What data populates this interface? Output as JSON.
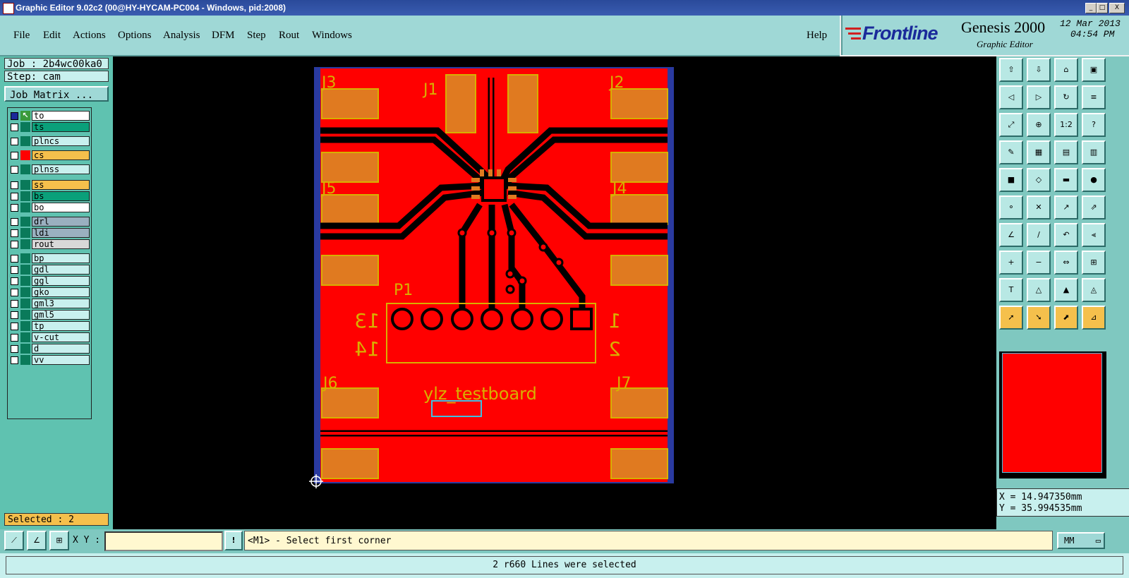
{
  "window": {
    "title": "Graphic Editor 9.02c2 (00@HY-HYCAM-PC004 - Windows, pid:2008)",
    "controls": [
      "_",
      "□",
      "X"
    ]
  },
  "menu": {
    "items": [
      "File",
      "Edit",
      "Actions",
      "Options",
      "Analysis",
      "DFM",
      "Step",
      "Rout",
      "Windows"
    ],
    "help": "Help"
  },
  "brand": {
    "logo": "Frontline",
    "product": "Genesis 2000",
    "subtitle": "Graphic Editor",
    "date": "12 Mar 2013",
    "time": "04:54 PM"
  },
  "left": {
    "job": "Job : 2b4wc00ka0",
    "step": "Step: cam",
    "job_matrix": "Job Matrix ...",
    "selected": "Selected : 2"
  },
  "layers": [
    {
      "name": "to",
      "color": "#ffffff",
      "slot": "#0a7a5a",
      "icon": "arrow"
    },
    {
      "name": "ts",
      "color": "#0aa07a",
      "slot": "#0a7a5a"
    },
    {
      "name": "plncs",
      "color": "#c8f0ee",
      "slot": "#0a7a5a"
    },
    {
      "name": "cs",
      "color": "#f5c04c",
      "slot": "#ff0000"
    },
    {
      "name": "plnss",
      "color": "#c8f0ee",
      "slot": "#0a7a5a"
    },
    {
      "name": "ss",
      "color": "#f5c04c",
      "slot": "#0a7a5a"
    },
    {
      "name": "bs",
      "color": "#0aa07a",
      "slot": "#0a7a5a"
    },
    {
      "name": "bo",
      "color": "#ffffff",
      "slot": "#0a7a5a"
    },
    {
      "name": "drl",
      "color": "#9ab0c0",
      "slot": "#0a7a5a"
    },
    {
      "name": "ldi",
      "color": "#9ab0c0",
      "slot": "#0a7a5a"
    },
    {
      "name": "rout",
      "color": "#d8d8d8",
      "slot": "#0a7a5a"
    },
    {
      "name": "bp",
      "color": "#c8f0ee",
      "slot": "#0a7a5a"
    },
    {
      "name": "gdl",
      "color": "#c8f0ee",
      "slot": "#0a7a5a"
    },
    {
      "name": "ggl",
      "color": "#c8f0ee",
      "slot": "#0a7a5a"
    },
    {
      "name": "gko",
      "color": "#c8f0ee",
      "slot": "#0a7a5a"
    },
    {
      "name": "gml3",
      "color": "#c8f0ee",
      "slot": "#0a7a5a"
    },
    {
      "name": "gml5",
      "color": "#c8f0ee",
      "slot": "#0a7a5a"
    },
    {
      "name": "tp",
      "color": "#c8f0ee",
      "slot": "#0a7a5a"
    },
    {
      "name": "v-cut",
      "color": "#c8f0ee",
      "slot": "#0a7a5a"
    },
    {
      "name": "d",
      "color": "#c8f0ee",
      "slot": "#0a7a5a"
    },
    {
      "name": "vv",
      "color": "#c8f0ee",
      "slot": "#0a7a5a"
    }
  ],
  "board": {
    "labels": {
      "j1": "J1",
      "j2": "J2",
      "j3": "J3",
      "j4": "J4",
      "j5": "J5",
      "j6": "J6",
      "j7": "J7",
      "p1": "P1",
      "n13": "13",
      "n14": "14",
      "n1": "1",
      "n2": "2",
      "name": "ylz_testboard"
    },
    "colors": {
      "copper": "#ff0000",
      "pad": "#e07a20",
      "silk": "#d8b000",
      "outline": "#2a3aa0",
      "select": "#40c0e0"
    }
  },
  "cmd": {
    "xy_label": "X Y :",
    "xy_value": "",
    "prompt": "<M1> - Select first corner",
    "units": "MM"
  },
  "status": {
    "message": "2 r660 Lines were selected"
  },
  "coords": {
    "x": "X = 14.947350mm",
    "y": "Y = 35.994535mm"
  },
  "toolbar": {
    "icons": [
      "zoom-in-icon",
      "zoom-out-icon",
      "home-icon",
      "window-icon",
      "pan-left-icon",
      "pan-right-icon",
      "redraw-icon",
      "fill-icon",
      "fit-icon",
      "center-icon",
      "scale-1-2-icon",
      "help-icon",
      "measure-icon",
      "grid-icon",
      "layers-icon",
      "layers-alt-icon",
      "pad-icon",
      "draw-icon",
      "ruler-icon",
      "dot-icon",
      "connect-icon",
      "cross-icon",
      "move-icon",
      "copy-icon",
      "line-icon",
      "arc-icon",
      "rotate-icon",
      "mirror-icon",
      "add-icon",
      "break-icon",
      "flip-icon",
      "array-icon",
      "text-icon",
      "triangle-icon",
      "triangle-up-icon",
      "shape-icon",
      "select-icon",
      "select-area-icon",
      "select-inside-icon",
      "select-path-icon"
    ],
    "scale_label": "1:2",
    "help_label": "?"
  }
}
